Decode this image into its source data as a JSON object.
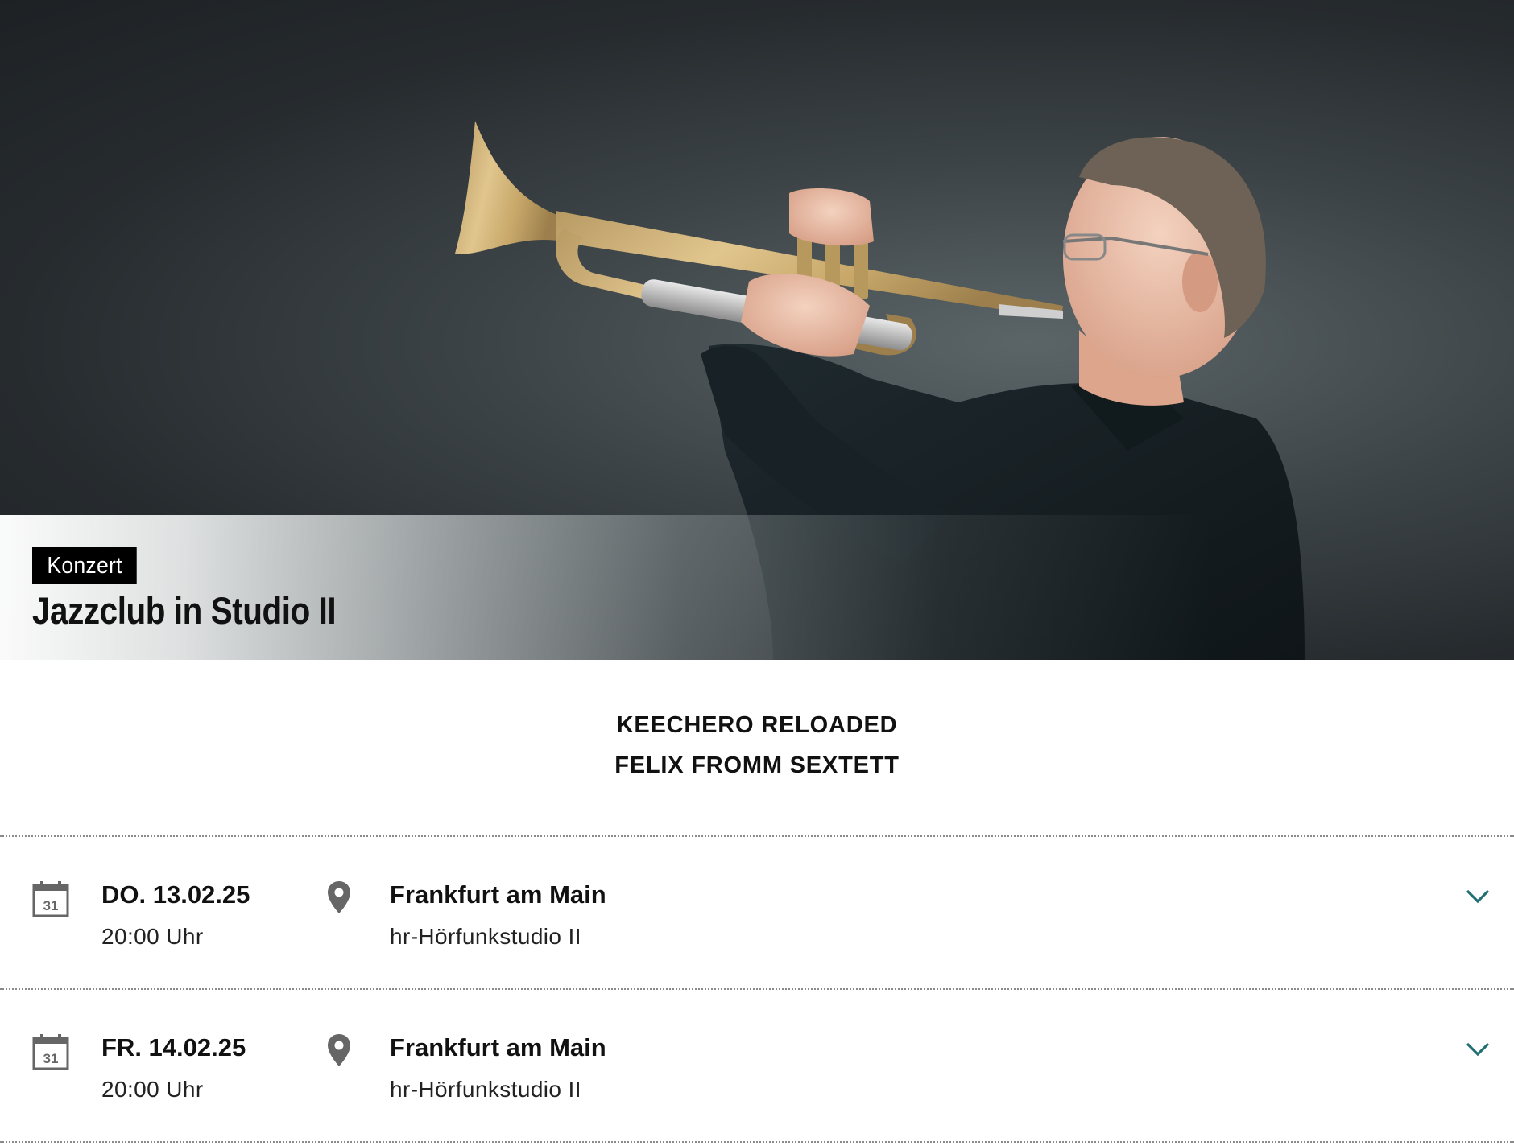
{
  "hero": {
    "category_tag": "Konzert",
    "title": "Jazzclub in Studio II"
  },
  "acts": [
    "KEECHERO RELOADED",
    "FELIX FROMM SEXTETT"
  ],
  "events": [
    {
      "date": "DO. 13.02.25",
      "time": "20:00 Uhr",
      "city": "Frankfurt am Main",
      "venue": "hr-Hörfunkstudio II",
      "calendar_day": "31"
    },
    {
      "date": "FR. 14.02.25",
      "time": "20:00 Uhr",
      "city": "Frankfurt am Main",
      "venue": "hr-Hörfunkstudio II",
      "calendar_day": "31"
    }
  ],
  "colors": {
    "accent_chevron": "#1f6f73",
    "icon_gray": "#666666",
    "tag_bg": "#000000"
  },
  "icons": {
    "calendar": "calendar-icon",
    "location": "location-pin-icon",
    "expand": "chevron-down-icon"
  }
}
